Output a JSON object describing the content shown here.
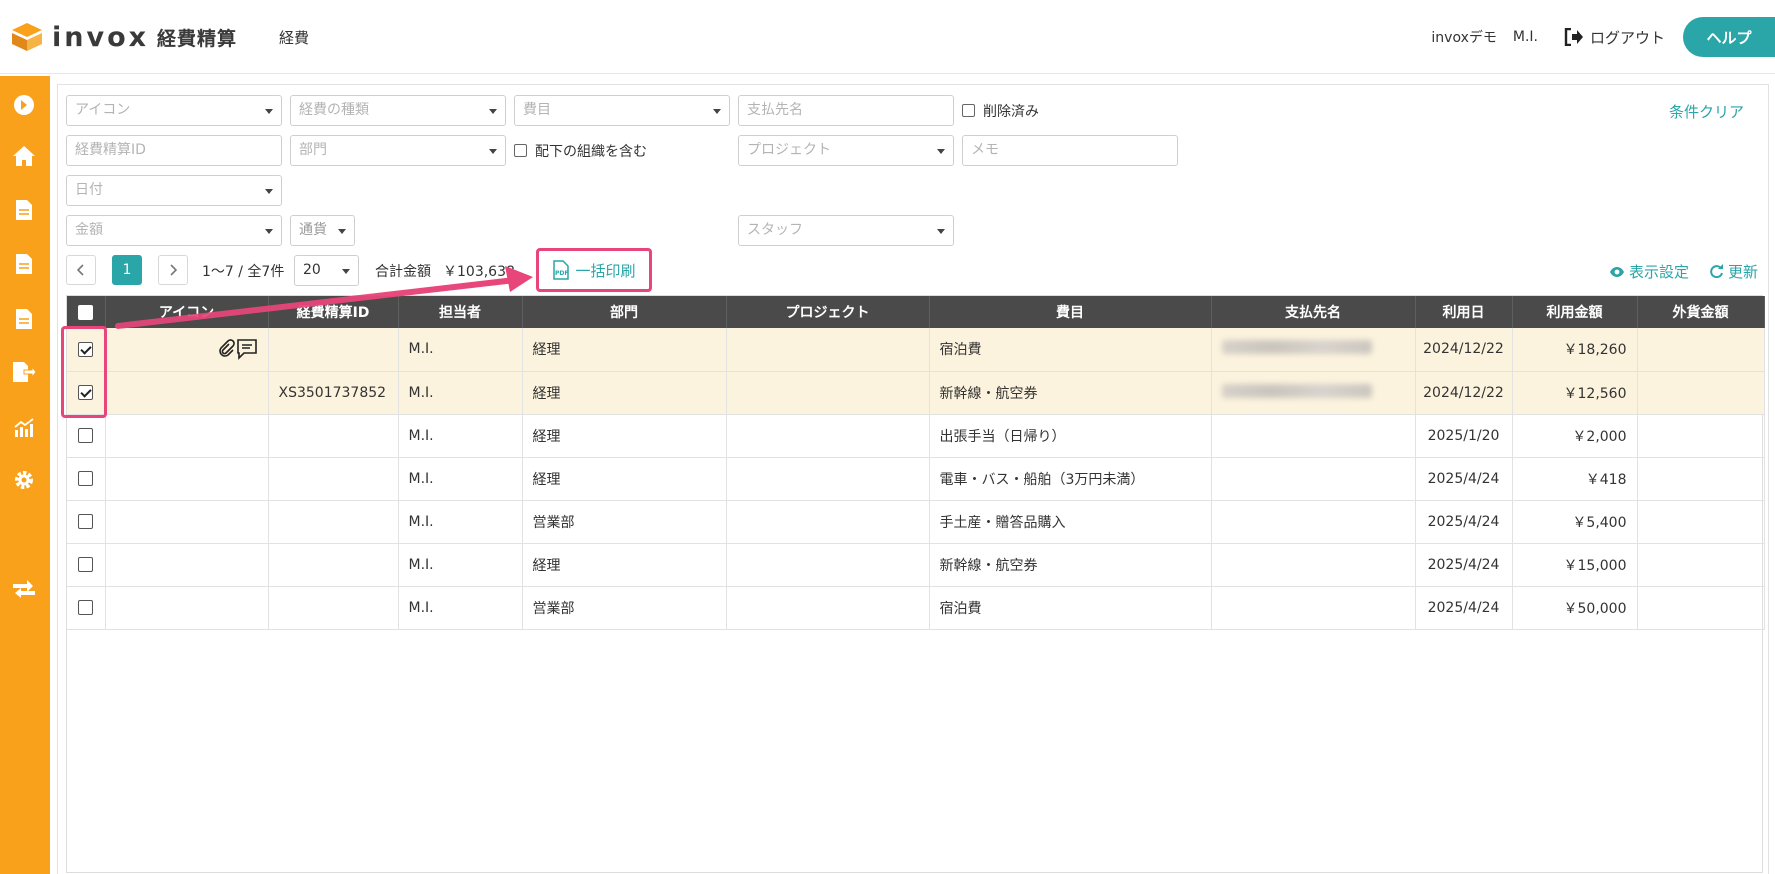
{
  "header": {
    "logo_text": "invox",
    "logo_sub": "経費精算",
    "nav_item": "経費",
    "company": "invoxデモ",
    "user": "M.I.",
    "logout": "ログアウト",
    "help": "ヘルプ"
  },
  "colors": {
    "accent": "#2aa5a8",
    "sidebar": "#f9a11b",
    "highlight": "#e8457a",
    "selected_row": "#fcf3de"
  },
  "sidebar": {
    "icons": [
      "arrow-right-circle-icon",
      "home-icon",
      "document-icon",
      "document-icon",
      "document-icon",
      "document-export-icon",
      "chart-icon",
      "gear-icon",
      "transfer-icon"
    ]
  },
  "filters": {
    "icon": "アイコン",
    "expense_type": "経費の種類",
    "category": "費目",
    "payee": "支払先名",
    "deleted": "削除済み",
    "clear": "条件クリア",
    "expense_id": "経費精算ID",
    "department": "部門",
    "include_sub": "配下の組織を含む",
    "project": "プロジェクト",
    "memo": "メモ",
    "date": "日付",
    "amount": "金額",
    "currency": "通貨",
    "staff": "スタッフ"
  },
  "pager": {
    "current_page": "1",
    "range": "1〜7 / 全7件",
    "per_page": "20",
    "total_label": "合計金額",
    "total_value": "￥103,638",
    "bulk_print": "一括印刷",
    "display_settings": "表示設定",
    "refresh": "更新"
  },
  "table": {
    "columns": [
      "アイコン",
      "経費精算ID",
      "担当者",
      "部門",
      "プロジェクト",
      "費目",
      "支払先名",
      "利用日",
      "利用金額",
      "外貨金額"
    ],
    "rows": [
      {
        "checked": true,
        "icons": true,
        "id": "",
        "staff": "M.I.",
        "dept": "経理",
        "project": "",
        "category": "宿泊費",
        "payee_blurred": true,
        "date": "2024/12/22",
        "amount": "￥18,260",
        "foreign": ""
      },
      {
        "checked": true,
        "icons": false,
        "id": "XS3501737852",
        "staff": "M.I.",
        "dept": "経理",
        "project": "",
        "category": "新幹線・航空券",
        "payee_blurred": true,
        "date": "2024/12/22",
        "amount": "￥12,560",
        "foreign": ""
      },
      {
        "checked": false,
        "icons": false,
        "id": "",
        "staff": "M.I.",
        "dept": "経理",
        "project": "",
        "category": "出張手当（日帰り）",
        "payee_blurred": false,
        "date": "2025/1/20",
        "amount": "￥2,000",
        "foreign": ""
      },
      {
        "checked": false,
        "icons": false,
        "id": "",
        "staff": "M.I.",
        "dept": "経理",
        "project": "",
        "category": "電車・バス・船舶（3万円未満）",
        "payee_blurred": false,
        "date": "2025/4/24",
        "amount": "￥418",
        "foreign": ""
      },
      {
        "checked": false,
        "icons": false,
        "id": "",
        "staff": "M.I.",
        "dept": "営業部",
        "project": "",
        "category": "手土産・贈答品購入",
        "payee_blurred": false,
        "date": "2025/4/24",
        "amount": "￥5,400",
        "foreign": ""
      },
      {
        "checked": false,
        "icons": false,
        "id": "",
        "staff": "M.I.",
        "dept": "経理",
        "project": "",
        "category": "新幹線・航空券",
        "payee_blurred": false,
        "date": "2025/4/24",
        "amount": "￥15,000",
        "foreign": ""
      },
      {
        "checked": false,
        "icons": false,
        "id": "",
        "staff": "M.I.",
        "dept": "営業部",
        "project": "",
        "category": "宿泊費",
        "payee_blurred": false,
        "date": "2025/4/24",
        "amount": "￥50,000",
        "foreign": ""
      }
    ]
  }
}
